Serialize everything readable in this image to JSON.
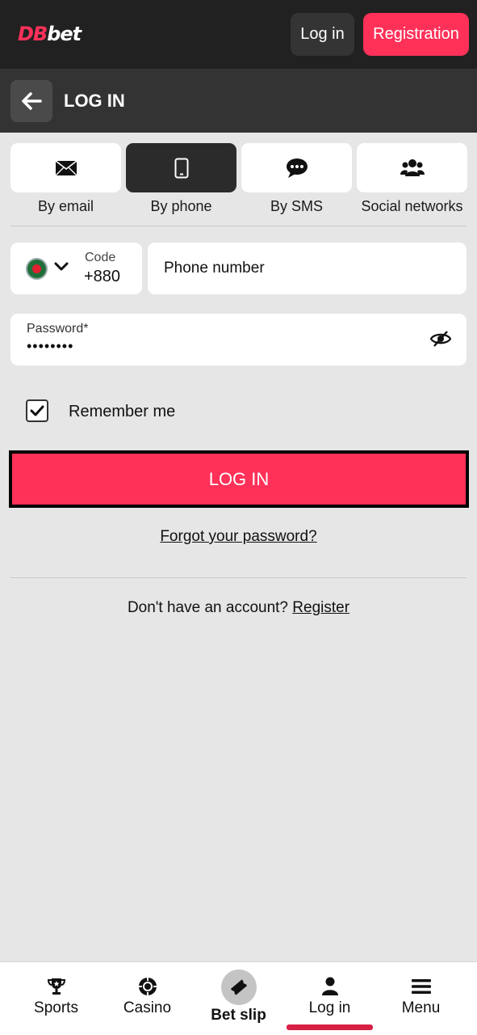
{
  "header": {
    "logo_db": "DB",
    "logo_bet": "bet",
    "login_label": "Log in",
    "registration_label": "Registration"
  },
  "page": {
    "title": "LOG IN"
  },
  "methods": [
    {
      "label": "By email",
      "icon": "envelope-icon"
    },
    {
      "label": "By phone",
      "icon": "phone-icon",
      "active": true
    },
    {
      "label": "By SMS",
      "icon": "chat-icon"
    },
    {
      "label": "Social networks",
      "icon": "users-icon"
    }
  ],
  "phone": {
    "code_label": "Code",
    "code_value": "+880",
    "placeholder": "Phone number"
  },
  "password": {
    "label": "Password*",
    "value": "••••••••"
  },
  "remember": {
    "label": "Remember me",
    "checked": true
  },
  "actions": {
    "login_label": "LOG IN",
    "forgot_label": "Forgot your password?",
    "no_account_text": "Don't have an account?",
    "register_label": "Register"
  },
  "colors": {
    "accent": "#ff3159",
    "topbar": "#212121",
    "pagehead": "#333333",
    "background": "#e6e6e6"
  },
  "bottom_nav": [
    {
      "label": "Sports",
      "icon": "trophy-icon"
    },
    {
      "label": "Casino",
      "icon": "casino-chip-icon"
    },
    {
      "label": "Bet slip",
      "icon": "ticket-icon"
    },
    {
      "label": "Log in",
      "icon": "user-icon",
      "active": true
    },
    {
      "label": "Menu",
      "icon": "hamburger-icon"
    }
  ]
}
